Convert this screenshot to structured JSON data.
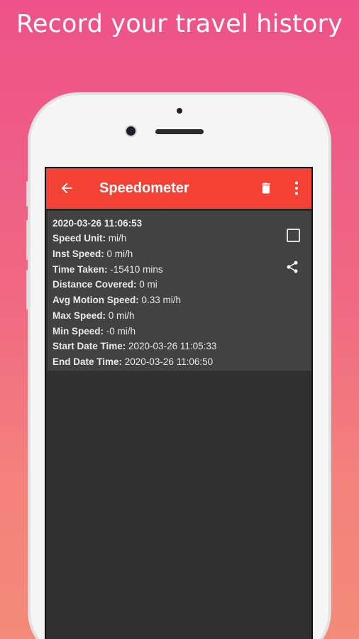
{
  "headline": "Record your travel history",
  "app_bar": {
    "title": "Speedometer",
    "back_icon": "arrow-left-icon",
    "delete_icon": "trash-icon",
    "more_icon": "more-vert-icon",
    "color": "#f44336"
  },
  "record": {
    "date_time": "2020-03-26 11:06:53",
    "fields": [
      {
        "label": "Speed Unit:",
        "value": " mi/h"
      },
      {
        "label": "Inst Speed:",
        "value": " 0  mi/h"
      },
      {
        "label": "Time Taken:",
        "value": " -15410 mins"
      },
      {
        "label": "Distance Covered:",
        "value": " 0  mi"
      },
      {
        "label": "Avg Motion Speed:",
        "value": " 0.33  mi/h"
      },
      {
        "label": "Max Speed:",
        "value": " 0  mi/h"
      },
      {
        "label": "Min Speed:",
        "value": " -0  mi/h"
      },
      {
        "label": "Start Date Time:",
        "value": " 2020-03-26 11:05:33"
      },
      {
        "label": "End Date Time:",
        "value": " 2020-03-26 11:06:50"
      }
    ],
    "select_icon": "checkbox-outline-icon",
    "share_icon": "share-icon"
  }
}
